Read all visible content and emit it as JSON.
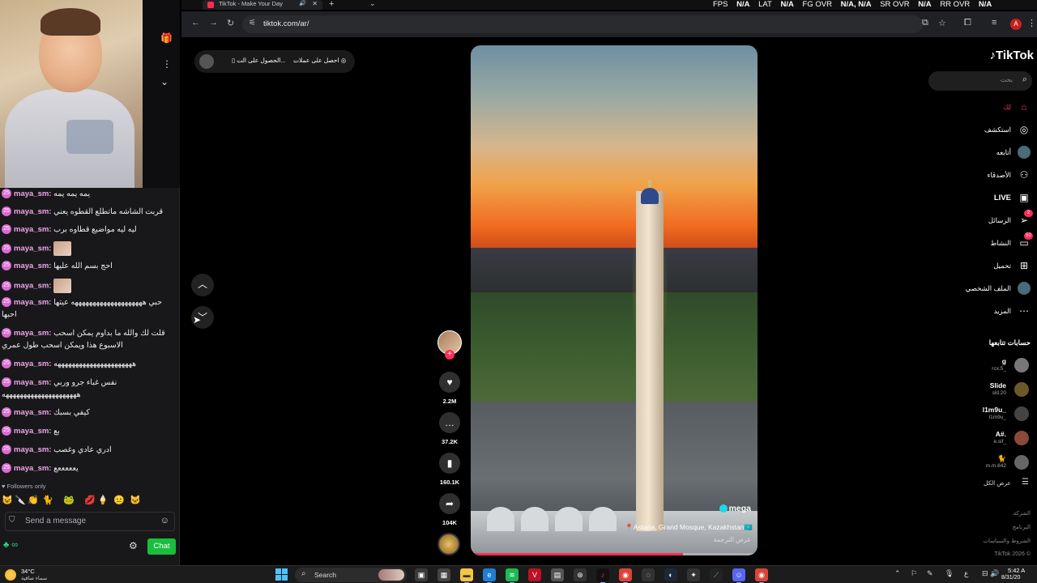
{
  "browser": {
    "tab_title": "TikTok - Make Your Day",
    "url": "tiktok.com/ar/",
    "profile_initial": "A"
  },
  "perf_overlay": {
    "fps_label": "FPS",
    "fps_value": "N/A",
    "lat_label": "LAT",
    "lat_value": "N/A",
    "fg_label": "FG OVR",
    "fg_value": "N/A, N/A",
    "sr_label": "SR OVR",
    "sr_value": "N/A",
    "rr_label": "RR OVR",
    "rr_value": "N/A"
  },
  "chat": {
    "messages": [
      {
        "user": "maya_sm:",
        "text": "يمه يمه يمه"
      },
      {
        "user": "maya_sm:",
        "text": "قربت الشاشه ماتطلع القطوه يعني"
      },
      {
        "user": "maya_sm:",
        "text": "ليه ليه مواضيع قطاوه برب"
      },
      {
        "user": "maya_sm:",
        "text": ""
      },
      {
        "user": "maya_sm:",
        "text": "احج بسم الله عليها"
      },
      {
        "user": "maya_sm:",
        "text": ""
      },
      {
        "user": "maya_sm:",
        "text": "حبي ههههههههههههههههههههه عيتها احبها"
      },
      {
        "user": "maya_sm:",
        "text": "قلت لك والله ما بداوم يمكن اسحب الاسبوع هذا ويمكن اسحب طول عمري"
      },
      {
        "user": "maya_sm:",
        "text": "ههههههههههههههههههههههه"
      },
      {
        "user": "maya_sm:",
        "text": "نفس غباء جرو وربي هههههههههههههههههههههه"
      },
      {
        "user": "maya_sm:",
        "text": "كيفي بسبك"
      },
      {
        "user": "maya_sm:",
        "text": "بع"
      },
      {
        "user": "maya_sm:",
        "text": "ادري عادي وغصب"
      },
      {
        "user": "maya_sm:",
        "text": "يعععععع"
      }
    ],
    "followers_only": "Followers only",
    "input_placeholder": "Send a message",
    "points": "∞",
    "chat_button": "Chat"
  },
  "tiktok": {
    "brand": "TikTok",
    "search_placeholder": "بحث",
    "top_actions": {
      "get_app": "الحصول على الت...",
      "get_coins": "احصل على عملات"
    },
    "nav": [
      {
        "label": "لك",
        "icon": "home-icon"
      },
      {
        "label": "استكشف",
        "icon": "compass-icon"
      },
      {
        "label": "أتابعه",
        "icon": "following-icon"
      },
      {
        "label": "الأصدقاء",
        "icon": "friends-icon"
      },
      {
        "label": "LIVE",
        "icon": "live-icon"
      },
      {
        "label": "الرسائل",
        "icon": "messages-icon",
        "badge": "2"
      },
      {
        "label": "النشاط",
        "icon": "activity-icon",
        "badge": "52"
      },
      {
        "label": "تحميل",
        "icon": "upload-icon"
      },
      {
        "label": "الملف الشخصي",
        "icon": "profile-icon"
      },
      {
        "label": "المزيد",
        "icon": "more-icon"
      }
    ],
    "following_title": "حسابات تتابعها",
    "following": [
      {
        "name": "g",
        "handle": "rcx.5_"
      },
      {
        "name": "Slide",
        "handle": "sld.20"
      },
      {
        "name": "l1m9u_",
        "handle": "l1m9u_"
      },
      {
        "name": "A#.",
        "handle": "e.sif_"
      },
      {
        "name": "🐈",
        "handle": "m.m.842"
      }
    ],
    "see_all": "عرض الكل",
    "footer": [
      "الشركة",
      "البرنامج",
      "الشروط والسياسات",
      "TikTok 2026 ©"
    ],
    "video": {
      "author": "mega",
      "caption": "📍Astana, Grand Mosque, Kazakhstan🇰🇿",
      "translate": "عرض الترجمة",
      "progress": 0.74
    },
    "rail": {
      "likes": "2.2M",
      "comments": "37.2K",
      "saves": "160.1K",
      "shares": "104K"
    }
  },
  "taskbar": {
    "temp": "34°C",
    "weather_desc": "سماء صافية",
    "search_label": "Search",
    "lang": "ع",
    "time": "5:42 A",
    "date": "8/31/20"
  }
}
